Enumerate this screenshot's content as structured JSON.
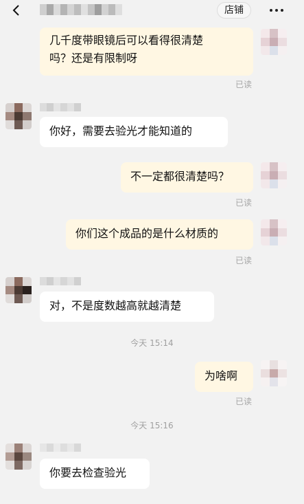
{
  "header": {
    "shop_label": "店铺"
  },
  "messages": [
    {
      "text_line1": "几千度带眼镜后可以看得很清楚",
      "text_line2": "吗？还是有限制呀",
      "status": "已读"
    },
    {
      "text": "你好，需要去验光才能知道的"
    },
    {
      "text": "不一定都很清楚吗？",
      "status": "已读"
    },
    {
      "text": "你们这个成品的是什么材质的",
      "status": "已读"
    },
    {
      "text": "对，不是度数越高就越清楚"
    },
    {
      "time": "今天 15:14"
    },
    {
      "text": "为啥啊",
      "status": "已读"
    },
    {
      "time": "今天 15:16"
    },
    {
      "text": "你要去检查验光"
    }
  ]
}
